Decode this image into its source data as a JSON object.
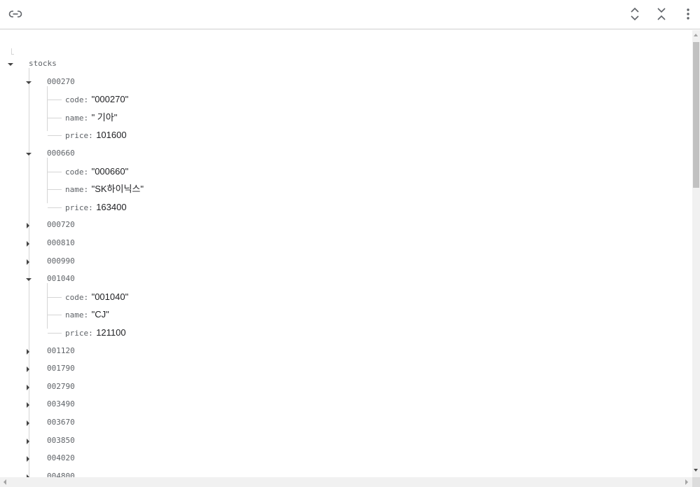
{
  "toolbar": {
    "link_icon": "link-icon",
    "expand_icon": "unfold-more-icon",
    "collapse_icon": "unfold-less-icon",
    "menu_icon": "more-vert-icon"
  },
  "tree": {
    "root": "stocks",
    "nodes": [
      {
        "key": "000270",
        "expanded": true,
        "fields": [
          {
            "name": "code:",
            "value": "\"000270\""
          },
          {
            "name": "name:",
            "value": "\" 기아\""
          },
          {
            "name": "price:",
            "value": "101600"
          }
        ]
      },
      {
        "key": "000660",
        "expanded": true,
        "fields": [
          {
            "name": "code:",
            "value": "\"000660\""
          },
          {
            "name": "name:",
            "value": "\"SK하이닉스\""
          },
          {
            "name": "price:",
            "value": "163400"
          }
        ]
      },
      {
        "key": "000720",
        "expanded": false,
        "fields": []
      },
      {
        "key": "000810",
        "expanded": false,
        "fields": []
      },
      {
        "key": "000990",
        "expanded": false,
        "fields": []
      },
      {
        "key": "001040",
        "expanded": true,
        "fields": [
          {
            "name": "code:",
            "value": "\"001040\""
          },
          {
            "name": "name:",
            "value": "\"CJ\""
          },
          {
            "name": "price:",
            "value": "121100"
          }
        ]
      },
      {
        "key": "001120",
        "expanded": false,
        "fields": []
      },
      {
        "key": "001790",
        "expanded": false,
        "fields": []
      },
      {
        "key": "002790",
        "expanded": false,
        "fields": []
      },
      {
        "key": "003490",
        "expanded": false,
        "fields": []
      },
      {
        "key": "003670",
        "expanded": false,
        "fields": []
      },
      {
        "key": "003850",
        "expanded": false,
        "fields": []
      },
      {
        "key": "004020",
        "expanded": false,
        "fields": []
      },
      {
        "key": "004800",
        "expanded": false,
        "fields": []
      }
    ]
  },
  "colors": {
    "key_text": "#5f6368",
    "value_text": "#202124",
    "guide_line": "#d5d5d5"
  }
}
